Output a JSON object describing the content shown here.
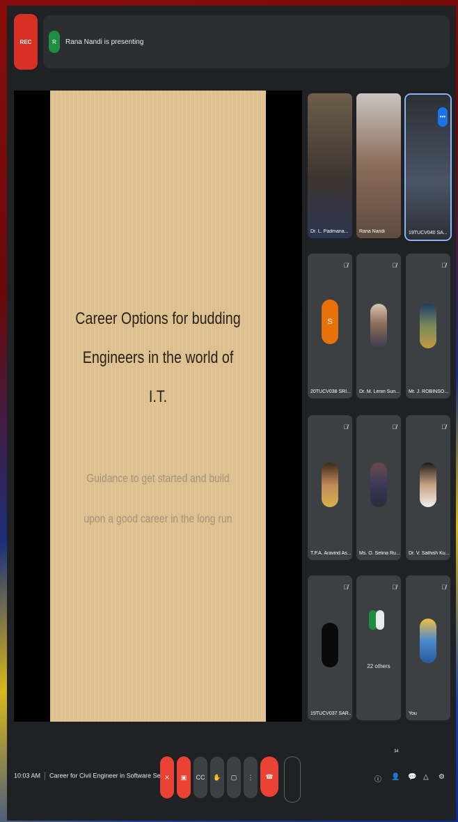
{
  "top": {
    "rec_label": "REC",
    "presenter_initial": "R",
    "presenting_text": "Rana Nandi is presenting"
  },
  "slide": {
    "title_line1": "Career Options for budding",
    "title_line2": "Engineers in the world of I.T.",
    "subtitle_line1": "Guidance to get started and build",
    "subtitle_line2": "upon a good career in the long run"
  },
  "participants": [
    {
      "name": "Dr. L. Padmana..."
    },
    {
      "name": "Rana Nandi"
    },
    {
      "name": "19TUCV040 SA..."
    },
    {
      "name": "20TUCV038 SRI...",
      "initial": "S"
    },
    {
      "name": "Dr. M. Lenin Sun..."
    },
    {
      "name": "Mr. J. ROBINSO..."
    },
    {
      "name": "T.P.A. Aravind As..."
    },
    {
      "name": "Ms. O. Selina Ru..."
    },
    {
      "name": "Dr. V. Sathish Ku..."
    },
    {
      "name": "19TUCV037 SAR..."
    },
    {
      "name": "22 others"
    },
    {
      "name": "You"
    }
  ],
  "bottom": {
    "time": "10:03 AM",
    "meeting_title": "Career for Civil Engineer in Software Sector",
    "people_count": "34"
  },
  "colors": {
    "meet_bg": "#202124",
    "tile_bg": "#3c4043",
    "danger": "#ea4335",
    "accent": "#8ab4f8"
  },
  "icons": [
    "mic-off-icon",
    "camera-off-icon",
    "captions-icon",
    "raise-hand-icon",
    "present-icon",
    "more-options-icon",
    "end-call-icon",
    "info-icon",
    "people-icon",
    "chat-icon",
    "activities-icon",
    "host-controls-icon"
  ]
}
